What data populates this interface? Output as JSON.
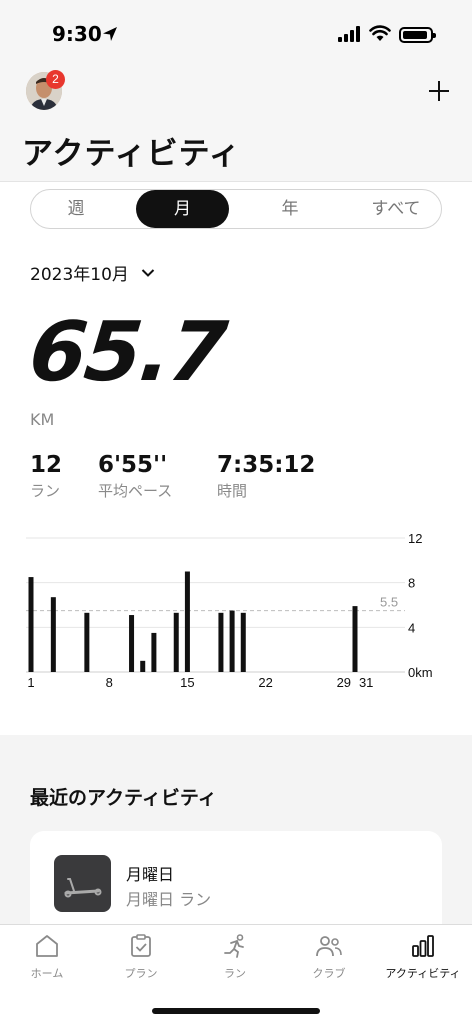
{
  "status_bar": {
    "time": "9:30"
  },
  "header": {
    "title": "アクティビティ",
    "avatar_badge": "2"
  },
  "segment": {
    "tabs": [
      "週",
      "月",
      "年",
      "すべて"
    ],
    "active_index": 1
  },
  "period": {
    "label": "2023年10月"
  },
  "summary": {
    "total": "65.7",
    "unit": "KM",
    "stats": [
      {
        "value": "12",
        "label": "ラン"
      },
      {
        "value": "6'55''",
        "label": "平均ペース"
      },
      {
        "value": "7:35:12",
        "label": "時間"
      }
    ]
  },
  "chart_data": {
    "type": "bar",
    "x": [
      1,
      3,
      6,
      10,
      11,
      12,
      14,
      15,
      18,
      19,
      20,
      30
    ],
    "values": [
      8.5,
      6.7,
      5.3,
      5.1,
      1.0,
      3.5,
      5.3,
      9.0,
      5.3,
      5.5,
      5.3,
      5.9
    ],
    "x_tick_labels": [
      "1",
      "8",
      "15",
      "22",
      "29",
      "31"
    ],
    "y_tick_labels": [
      "12",
      "8",
      "4",
      "0km"
    ],
    "ylim": [
      0,
      12
    ],
    "average_line": 5.5,
    "average_label": "5.5",
    "grid": true
  },
  "recent": {
    "title": "最近のアクティビティ",
    "item": {
      "day": "月曜日",
      "subtitle": "月曜日 ラン"
    }
  },
  "tab_bar": {
    "items": [
      {
        "label": "ホーム",
        "icon": "home-icon"
      },
      {
        "label": "プラン",
        "icon": "plan-icon"
      },
      {
        "label": "ラン",
        "icon": "run-icon"
      },
      {
        "label": "クラブ",
        "icon": "club-icon"
      },
      {
        "label": "アクティビティ",
        "icon": "activity-icon"
      }
    ],
    "active_index": 4
  }
}
